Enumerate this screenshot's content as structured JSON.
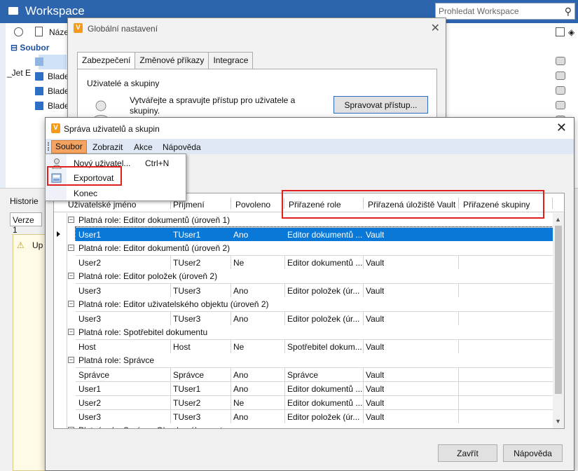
{
  "workspace": {
    "title": "Workspace",
    "search_placeholder": "Prohledat Workspace",
    "column_name": "Náze",
    "tree_root": "Soubor",
    "rows": [
      "_Jet E",
      "Blade",
      "Blade",
      "Blade"
    ],
    "lower_tab": "Historie",
    "lower_version": "Verze 1",
    "lower_warning": "Up"
  },
  "global_dialog": {
    "title": "Globální nastavení",
    "tabs": [
      "Zabezpečení",
      "Změnové příkazy",
      "Integrace"
    ],
    "section_title": "Uživatelé a skupiny",
    "description": "Vytvářejte a spravujte přístup pro uživatele a skupiny.",
    "manage_button": "Spravovat přístup..."
  },
  "users_dialog": {
    "title": "Správa uživatelů a skupin",
    "menu": [
      "Soubor",
      "Zobrazit",
      "Akce",
      "Nápověda"
    ],
    "file_menu": [
      {
        "label": "Nový uživatel...",
        "shortcut": "Ctrl+N"
      },
      {
        "label": "Exportovat",
        "shortcut": ""
      },
      {
        "label": "Konec",
        "shortcut": ""
      }
    ],
    "columns": [
      "Uživatelské jméno",
      "Příjmení",
      "Povoleno",
      "Přiřazené role",
      "Přiřazená úložiště Vault",
      "Přiřazené skupiny"
    ],
    "groups": [
      {
        "label": "Platná role: Editor dokumentů (úroveň 1)",
        "rows": [
          [
            "User1",
            "TUser1",
            "Ano",
            "Editor dokumentů ...",
            "Vault",
            ""
          ]
        ]
      },
      {
        "label": "Platná role: Editor dokumentů (úroveň 2)",
        "rows": [
          [
            "User2",
            "TUser2",
            "Ne",
            "Editor dokumentů ...",
            "Vault",
            ""
          ]
        ]
      },
      {
        "label": "Platná role: Editor položek (úroveň 2)",
        "rows": [
          [
            "User3",
            "TUser3",
            "Ano",
            "Editor položek (úr...",
            "Vault",
            ""
          ]
        ]
      },
      {
        "label": "Platná role: Editor uživatelského objektu (úroveň 2)",
        "rows": [
          [
            "User3",
            "TUser3",
            "Ano",
            "Editor položek (úr...",
            "Vault",
            ""
          ]
        ]
      },
      {
        "label": "Platná role: Spotřebitel dokumentu",
        "rows": [
          [
            "Host",
            "Host",
            "Ne",
            "Spotřebitel dokum...",
            "Vault",
            ""
          ]
        ]
      },
      {
        "label": "Platná role: Správce",
        "rows": [
          [
            "Správce",
            "Správce",
            "Ano",
            "Správce",
            "Vault",
            ""
          ],
          [
            "User1",
            "TUser1",
            "Ano",
            "Editor dokumentů ...",
            "Vault",
            ""
          ],
          [
            "User2",
            "TUser2",
            "Ne",
            "Editor dokumentů ...",
            "Vault",
            ""
          ],
          [
            "User3",
            "TUser3",
            "Ano",
            "Editor položek (úr...",
            "Vault",
            ""
          ]
        ]
      },
      {
        "label": "Platná role: Správce Obsahového centra",
        "rows": []
      }
    ],
    "close_button": "Zavřít",
    "help_button": "Nápověda"
  },
  "colors": {
    "titlebar": "#2c65ad",
    "selection": "#0a78d7",
    "highlight_box": "#e0201c",
    "menu_open": "#f4a460"
  }
}
